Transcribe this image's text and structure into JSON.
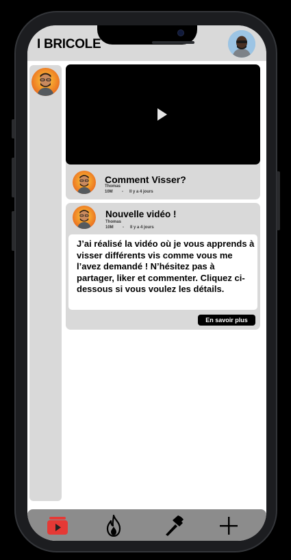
{
  "header": {
    "title": "I BRICOLE"
  },
  "video_card": {
    "title": "Comment Visser?",
    "author": "Thomas",
    "views": "10M",
    "separator": "-",
    "time": "Il y a 4 jours"
  },
  "post_card": {
    "title": "Nouvelle vidéo !",
    "author": "Thomas",
    "views": "10M",
    "separator": "-",
    "time": "Il y a 4 jours",
    "body": "J’ai réalisé la vidéo où je vous apprends à visser différents vis comme vous me l’avez demandé ! N’hésitez pas à partager, liker et commenter. Cliquez ci-dessous si vous voulez les détails.",
    "button": "En savoir plus"
  },
  "tabbar": {
    "items": [
      {
        "icon": "video-play-icon",
        "color": "#e53935"
      },
      {
        "icon": "fire-icon"
      },
      {
        "icon": "hammer-icon"
      },
      {
        "icon": "plus-icon"
      }
    ]
  },
  "colors": {
    "panel": "#d9d9d9",
    "tabbar": "#8c8c8c",
    "accent": "#e53935"
  }
}
